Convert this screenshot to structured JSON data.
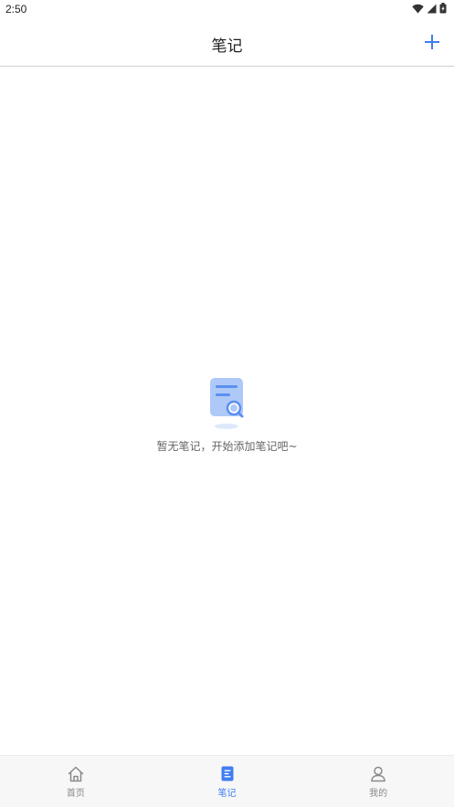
{
  "status_bar": {
    "time": "2:50"
  },
  "header": {
    "title": "笔记",
    "add_label": "+"
  },
  "empty_state": {
    "message": "暂无笔记，开始添加笔记吧~",
    "icon": "document-search-icon"
  },
  "bottom_nav": {
    "items": [
      {
        "label": "首页",
        "icon": "home-icon",
        "active": false
      },
      {
        "label": "笔记",
        "icon": "note-icon",
        "active": true
      },
      {
        "label": "我的",
        "icon": "user-icon",
        "active": false
      }
    ]
  },
  "colors": {
    "accent": "#3f7ef0",
    "inactive": "#8a8a8a",
    "divider": "#cfcfcf"
  }
}
